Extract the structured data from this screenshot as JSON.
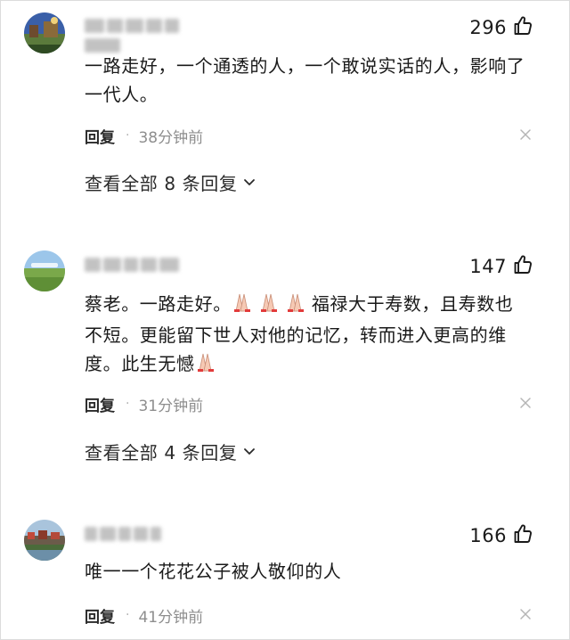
{
  "comments": [
    {
      "username": "blurred-username",
      "likes": "296",
      "text": "一路走好，一个通透的人，一个敢说实话的人，影响了一代人。",
      "reply_label": "回复",
      "separator": "·",
      "time": "38分钟前",
      "view_replies": "查看全部 8 条回复"
    },
    {
      "username": "blurred-username",
      "likes": "147",
      "text_before_emoji": "蔡老。一路走好。",
      "text_after_emoji": "福禄大于寿数，且寿数也不短。更能留下世人对他的记忆，转而进入更高的维度。此生无憾",
      "reply_label": "回复",
      "separator": "·",
      "time": "31分钟前",
      "view_replies": "查看全部 4 条回复"
    },
    {
      "username": "blurred-username",
      "likes": "166",
      "text": "唯一一个花花公子被人敬仰的人",
      "reply_label": "回复",
      "separator": "·",
      "time": "41分钟前"
    }
  ],
  "icons": {
    "like": "thumbs-up-icon",
    "dismiss": "close-icon",
    "expand": "chevron-down-icon",
    "emoji": "folded-hands-emoji"
  },
  "colors": {
    "text": "#1a1a1a",
    "muted": "#8e8e8e",
    "background": "#ffffff"
  }
}
